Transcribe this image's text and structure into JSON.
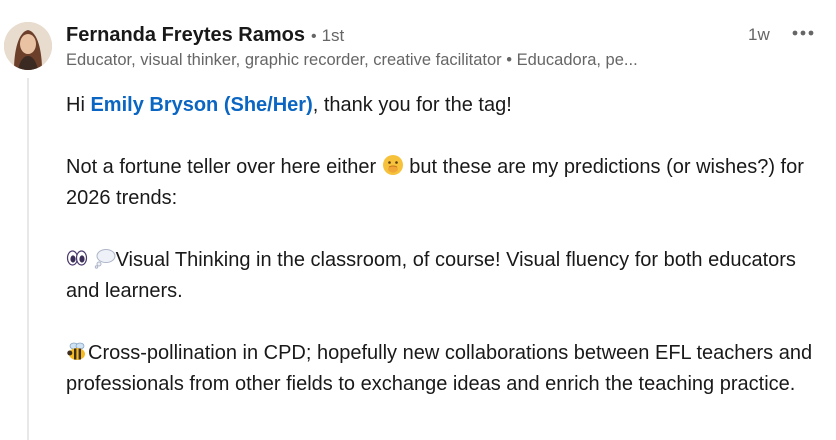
{
  "comment": {
    "author_name": "Fernanda Freytes Ramos",
    "separator": "•",
    "connection_degree": "1st",
    "headline": "Educator, visual thinker, graphic recorder, creative facilitator • Educadora, pe...",
    "timestamp": "1w",
    "more_icon": "ellipsis-horizontal-icon",
    "body": {
      "p1_before": "Hi ",
      "mention": "Emily Bryson (She/Her)",
      "p1_after": ", thank you for the tag!",
      "p2_before": "Not a fortune teller over here either ",
      "p2_emoji": "face-with-hand-over-mouth-emoji",
      "p2_after": " but these are my predictions (or wishes?) for 2026 trends:",
      "p3_emojis": [
        "eyes-emoji",
        "thought-balloon-emoji"
      ],
      "p3_text": "Visual Thinking in the classroom, of course! Visual fluency for both educators and learners.",
      "p4_emoji": "bee-emoji",
      "p4_text": "Cross-pollination in CPD; hopefully new collaborations between EFL teachers and professionals from other fields to exchange ideas and enrich the teaching practice."
    }
  },
  "colors": {
    "mention_link": "#0a66c2",
    "secondary_text": "#666666",
    "primary_text": "#191919",
    "thread_line": "#e8e8e8"
  }
}
